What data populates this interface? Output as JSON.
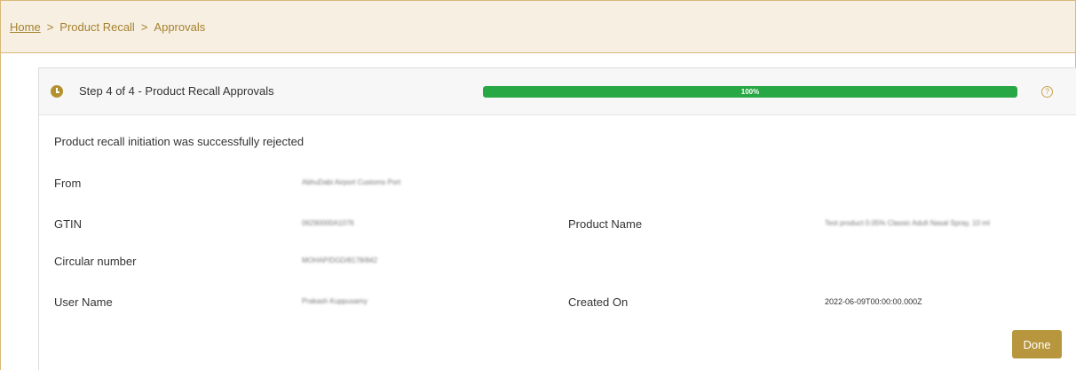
{
  "breadcrumb": {
    "home": "Home",
    "separator": ">",
    "items": [
      "Product Recall",
      "Approvals"
    ]
  },
  "step": {
    "title": "Step 4 of 4 - Product Recall Approvals",
    "progress_percent": 100,
    "progress_label": "100%",
    "help_glyph": "?"
  },
  "status_message": "Product recall initiation was successfully rejected",
  "fields": {
    "from": {
      "label": "From",
      "value": "AbhuDabi Airport Customs Port"
    },
    "gtin": {
      "label": "GTIN",
      "value": "06290000A1076"
    },
    "product_name": {
      "label": "Product Name",
      "value": "Test product 0.05% Classic Adult Nasal Spray, 10 ml"
    },
    "circular_number": {
      "label": "Circular number",
      "value": "MOHAP/DGD/8178/842"
    },
    "user_name": {
      "label": "User Name",
      "value": "Prakash Kuppusamy"
    },
    "created_on": {
      "label": "Created On",
      "value": "2022-06-09T00:00:00.000Z"
    }
  },
  "actions": {
    "done_label": "Done"
  },
  "colors": {
    "accent": "#b8963d",
    "breadcrumb_bg": "#f6efe2",
    "progress_fill": "#28a745"
  },
  "icons": {
    "step": "clock-icon",
    "help": "help-circle-icon"
  }
}
